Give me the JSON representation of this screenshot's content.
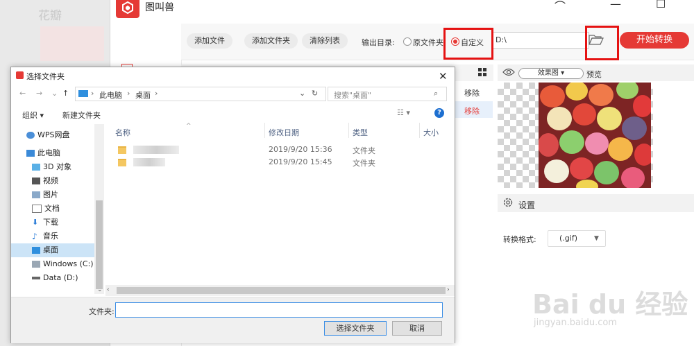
{
  "background": {
    "ghost_text": "花瓣"
  },
  "app": {
    "name": "图叫兽",
    "toolbar": {
      "add_file": "添加文件",
      "add_folder": "添加文件夹",
      "clear_list": "清除列表",
      "output_label": "输出目录:",
      "opt_original": "原文件夹",
      "opt_custom": "自定义",
      "output_path": "D:\\",
      "start": "开始转换"
    },
    "list": {
      "remove_1": "移除",
      "remove_2": "移除"
    },
    "preview": {
      "mode": "效果图",
      "label": "预览"
    },
    "settings": {
      "title": "设置",
      "format_label": "转换格式:",
      "format_value": "(.gif)"
    },
    "accent_color": "#e53935"
  },
  "dialog": {
    "title": "选择文件夹",
    "breadcrumb": [
      "此电脑",
      "桌面"
    ],
    "search_placeholder": "搜索\"桌面\"",
    "organize": "组织 ▾",
    "new_folder": "新建文件夹",
    "tree": [
      {
        "label": "WPS网盘",
        "icon": "cloud-icon"
      },
      {
        "label": "此电脑",
        "icon": "computer-icon"
      },
      {
        "label": "3D 对象",
        "icon": "cube-icon"
      },
      {
        "label": "视频",
        "icon": "video-icon"
      },
      {
        "label": "图片",
        "icon": "picture-icon"
      },
      {
        "label": "文档",
        "icon": "document-icon"
      },
      {
        "label": "下载",
        "icon": "download-icon"
      },
      {
        "label": "音乐",
        "icon": "music-icon"
      },
      {
        "label": "桌面",
        "icon": "desktop-icon",
        "selected": true
      },
      {
        "label": "Windows (C:)",
        "icon": "drive-icon"
      },
      {
        "label": "Data (D:)",
        "icon": "drive-icon"
      }
    ],
    "columns": {
      "name": "名称",
      "modified": "修改日期",
      "type": "类型",
      "size": "大小"
    },
    "files": [
      {
        "modified": "2019/9/20 15:36",
        "type": "文件夹"
      },
      {
        "modified": "2019/9/20 15:45",
        "type": "文件夹"
      }
    ],
    "filename_label": "文件夹:",
    "select_button": "选择文件夹",
    "cancel_button": "取消"
  },
  "watermark": {
    "logo": "Bai du 经验",
    "url": "jingyan.baidu.com"
  }
}
